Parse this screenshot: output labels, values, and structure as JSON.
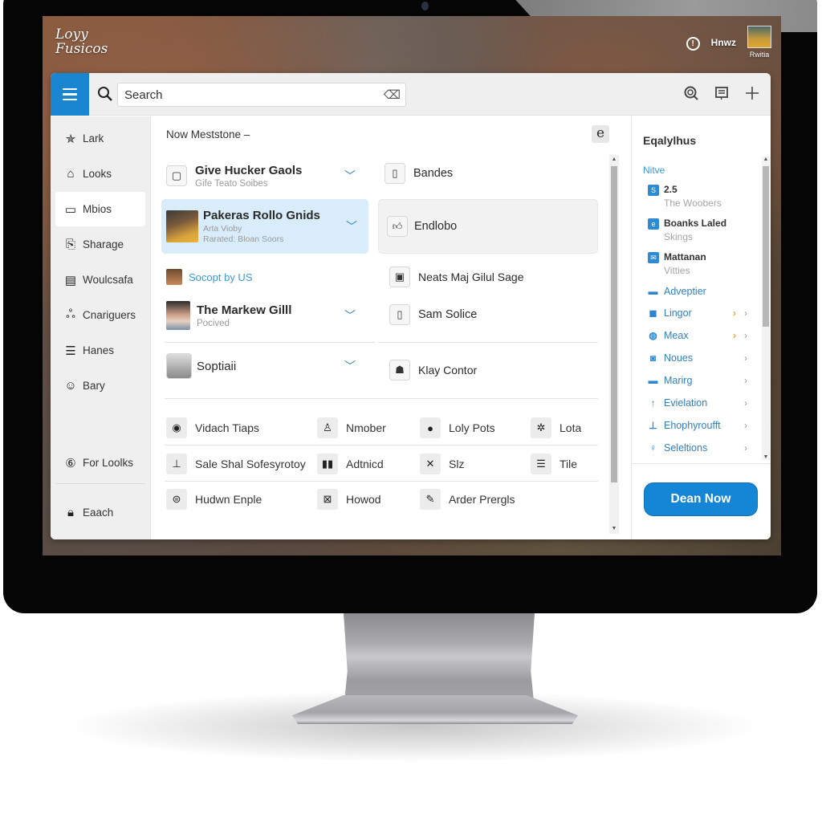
{
  "desktop": {
    "logo_line1": "Loyy",
    "logo_line2": "Fusicos",
    "top_user_label": "Hnwz",
    "top_avatar_name": "Rwitia"
  },
  "toolbar": {
    "search_placeholder": "Search",
    "search_value": "Search",
    "icons": [
      "menu-icon",
      "search-icon",
      "clear-icon",
      "zoom-icon",
      "notes-icon",
      "add-icon"
    ]
  },
  "sidebar": {
    "items": [
      {
        "label": "Lark",
        "icon": "star-figure-icon"
      },
      {
        "label": "Looks",
        "icon": "home-icon"
      },
      {
        "label": "Mbios",
        "icon": "monitor-icon",
        "active": true
      },
      {
        "label": "Sharage",
        "icon": "clipboard-icon"
      },
      {
        "label": "Woulcsafa",
        "icon": "document-icon"
      },
      {
        "label": "Cnariguers",
        "icon": "share-icon"
      },
      {
        "label": "Hanes",
        "icon": "list-icon"
      },
      {
        "label": "Bary",
        "icon": "people-icon"
      }
    ],
    "bottom_items": [
      {
        "label": "For Loolks",
        "icon": "number-six-icon"
      },
      {
        "label": "Eaach",
        "icon": "lock-icon"
      }
    ]
  },
  "main": {
    "section_title": "Now Meststone –",
    "e_button": "e",
    "left_cards": [
      {
        "title": "Give Hucker Gaols",
        "subtitle": "Gife Teato Soibes",
        "icon": "device-icon"
      },
      {
        "title": "Pakeras Rollo Gnids",
        "subtitle": "Arta Vioby",
        "subtitle2": "Rarated: Bloan Soors",
        "icon": "profile-photo",
        "selected": true
      }
    ],
    "link_item": {
      "label": "Socopt by US",
      "icon": "profile-photo"
    },
    "people_cards": [
      {
        "title": "The Markew Gilll",
        "subtitle": "Pocived",
        "icon": "profile-photo"
      },
      {
        "title": "Soptiaii",
        "subtitle": "",
        "icon": "profile-photo"
      }
    ],
    "right_items": [
      {
        "label": "Bandes",
        "icon": "phone-icon"
      },
      {
        "label": "Endlobo",
        "icon": "thumbs-up-icon",
        "highlighted": true
      },
      {
        "label": "Neats Maj Gilul Sage",
        "icon": "document-icon"
      },
      {
        "label": "Sam Solice",
        "icon": "phone-icon"
      },
      {
        "label": "Klay Contor",
        "icon": "user-group-icon"
      }
    ],
    "grid": [
      [
        {
          "label": "Vidach Tiaps",
          "icon": "record-icon"
        },
        {
          "label": "Nmober",
          "icon": "person-icon"
        },
        {
          "label": "Loly Pots",
          "icon": "user-badge-icon"
        },
        {
          "label": "Lota",
          "icon": "settings-icon"
        }
      ],
      [
        {
          "label": "Sale Shal Sofesyrotoy",
          "icon": "stamp-icon"
        },
        {
          "label": "Adtnicd",
          "icon": "columns-icon"
        },
        {
          "label": "Slz",
          "icon": "tools-icon"
        },
        {
          "label": "Tile",
          "icon": "stack-icon"
        }
      ],
      [
        {
          "label": "Hudwn Enple",
          "icon": "upload-circle-icon"
        },
        {
          "label": "Howod",
          "icon": "grid-box-icon"
        },
        {
          "label": "Arder Prergls",
          "icon": "pencil-icon"
        }
      ]
    ]
  },
  "right_panel": {
    "title": "Eqalylhus",
    "subtitle": "Nitve",
    "entries": [
      {
        "title": "2.5",
        "subtitle": "The Woobers",
        "icon": "s-badge-icon"
      },
      {
        "title": "Boanks Laled",
        "subtitle": "Skings",
        "icon": "e-badge-icon"
      },
      {
        "title": "Mattanan",
        "subtitle": "Vitties",
        "icon": "image-badge-icon"
      }
    ],
    "links": [
      {
        "label": "Adveptier",
        "icon": "dash-icon",
        "orange_arrow": false,
        "gray_arrow": false
      },
      {
        "label": "Lingor",
        "icon": "alert-square-icon",
        "orange_arrow": true,
        "gray_arrow": true
      },
      {
        "label": "Meax",
        "icon": "globe-icon",
        "orange_arrow": true,
        "gray_arrow": true
      },
      {
        "label": "Noues",
        "icon": "users-square-icon",
        "orange_arrow": false,
        "gray_arrow": true
      },
      {
        "label": "Marirg",
        "icon": "card-icon",
        "orange_arrow": false,
        "gray_arrow": true
      },
      {
        "label": "Evielation",
        "icon": "arrow-up-icon",
        "orange_arrow": false,
        "gray_arrow": true
      },
      {
        "label": "Ehophyroufft",
        "icon": "person-stand-icon",
        "orange_arrow": false,
        "gray_arrow": true
      },
      {
        "label": "Seleltions",
        "icon": "pin-person-icon",
        "orange_arrow": false,
        "gray_arrow": true
      }
    ],
    "cta_label": "Dean Now"
  },
  "colors": {
    "accent": "#1a86d1",
    "cta": "#1585d6",
    "selected_row": "#d9ecf9",
    "link": "#2f7fc0",
    "orange_arrow": "#f0a020"
  }
}
